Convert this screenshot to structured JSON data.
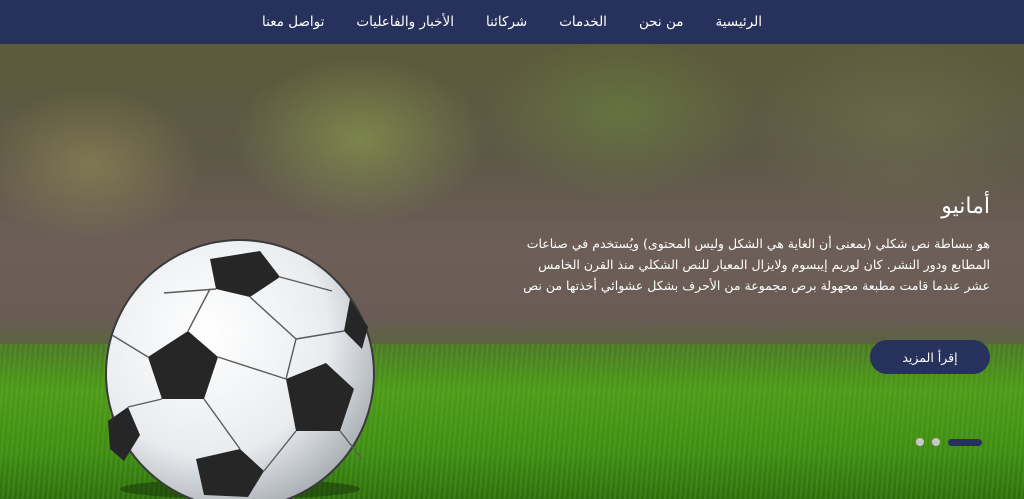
{
  "nav": {
    "items": [
      {
        "label": "الرئيسية"
      },
      {
        "label": "من نحن"
      },
      {
        "label": "الخدمات"
      },
      {
        "label": "شركائنا"
      },
      {
        "label": "الأخبار والفاعليات"
      },
      {
        "label": "تواصل معنا"
      }
    ]
  },
  "hero": {
    "title": "أمانيو",
    "text": "هو ببساطة نص شكلي (بمعنى أن الغاية هي الشكل وليس المحتوى) ويُستخدم في صناعات المطابع ودور النشر. كان لوريم إيبسوم ولايزال المعيار للنص الشكلي منذ القرن الخامس عشر عندما قامت مطبعة مجهولة برص مجموعة من الأحرف بشكل عشوائي أخذتها من نص",
    "button_label": "إقرأ المزيد",
    "slides": {
      "count": 3,
      "active_index": 0
    }
  },
  "colors": {
    "navbar": "#27325c",
    "button": "#27325c",
    "inactive_dot": "#c8c8c8"
  }
}
